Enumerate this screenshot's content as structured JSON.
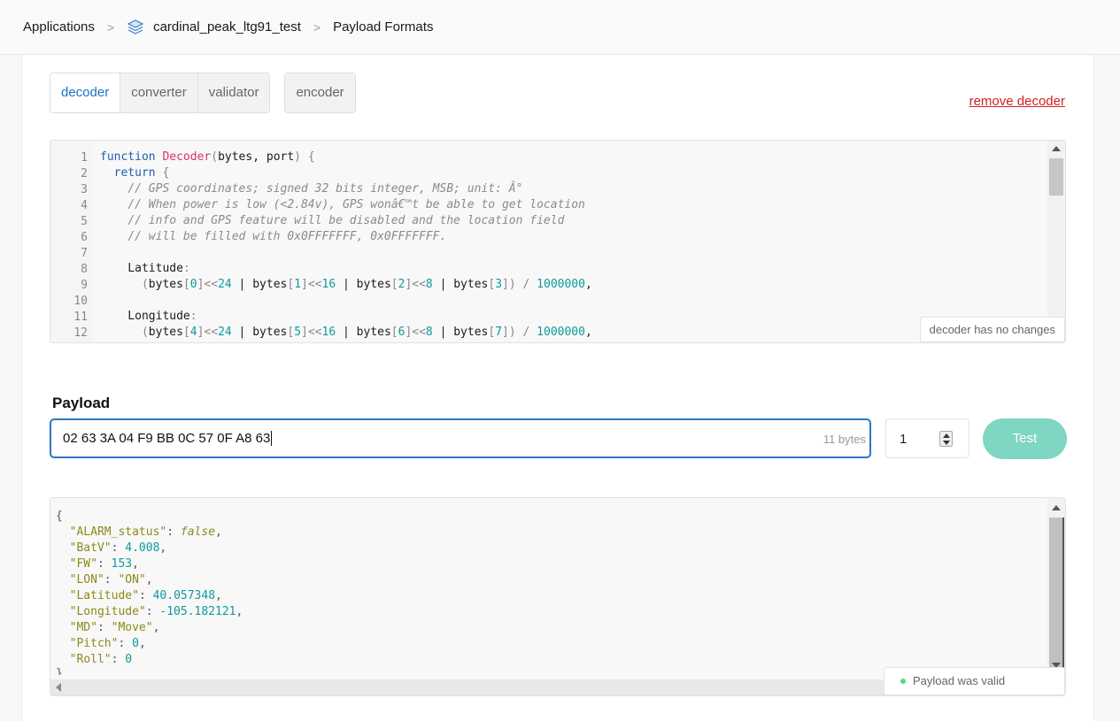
{
  "breadcrumb": {
    "applications": "Applications",
    "app_name": "cardinal_peak_ltg91_test",
    "page": "Payload Formats",
    "separator": ">"
  },
  "tabs": {
    "decoder": "decoder",
    "converter": "converter",
    "validator": "validator",
    "encoder": "encoder"
  },
  "remove_decoder": "remove decoder",
  "editor": {
    "status": "decoder has no changes",
    "line_numbers": [
      "1",
      "2",
      "3",
      "4",
      "5",
      "6",
      "7",
      "8",
      "9",
      "10",
      "11",
      "12"
    ]
  },
  "payload": {
    "label": "Payload",
    "value": "02 63 3A 04 F9 BB 0C 57 0F A8 63",
    "bytes": "11 bytes",
    "port": "1",
    "test_label": "Test"
  },
  "output": {
    "status": "Payload was valid"
  },
  "colors": {
    "accent": "#2b78c6",
    "test_button": "#7fd6c3",
    "danger": "#d42020",
    "valid_dot": "#56d685"
  }
}
